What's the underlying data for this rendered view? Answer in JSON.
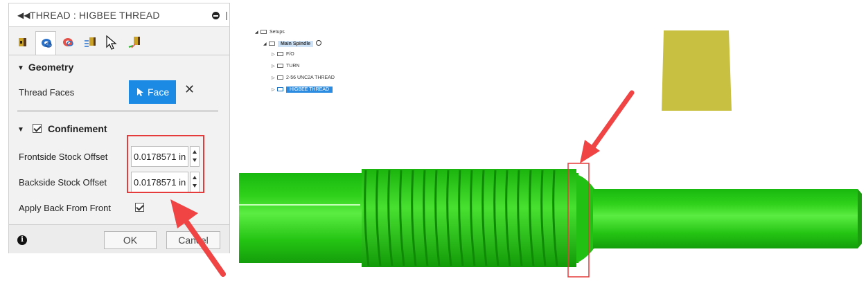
{
  "dialog": {
    "title": "THREAD : HIGBEE THREAD",
    "geometry": {
      "heading": "Geometry",
      "thread_faces_label": "Thread Faces",
      "face_button": "Face"
    },
    "confinement": {
      "heading": "Confinement",
      "frontside_label": "Frontside Stock Offset",
      "frontside_value": "0.0178571 in",
      "backside_label": "Backside Stock Offset",
      "backside_value": "0.0178571 in",
      "apply_back_label": "Apply Back From Front"
    },
    "footer": {
      "ok": "OK",
      "cancel": "Cancel"
    }
  },
  "tree": {
    "setups": "Setups",
    "main_spindle": "Main Spindle",
    "items": [
      "F/O",
      "TURN",
      "2-56 UNC2A THREAD",
      "HIGBEE THREAD"
    ]
  },
  "colors": {
    "accent": "#1a8ae5",
    "annotation": "#e53b3b",
    "part_green": "#2fd11a",
    "stock_yellow": "#c8c040"
  }
}
